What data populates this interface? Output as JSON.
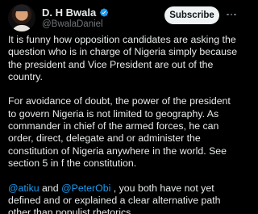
{
  "author": {
    "display_name": "D. H Bwala",
    "handle": "@BwalaDaniel",
    "verified_icon": "verified-badge-icon",
    "verified_color": "#1d9bf0"
  },
  "actions": {
    "subscribe_label": "Subscribe",
    "more_icon": "more-options-icon"
  },
  "tweet": {
    "paragraph1": "It is funny how opposition candidates are asking  the question who is in charge of Nigeria simply because the president and Vice President are out of the country.",
    "paragraph2": "For avoidance of doubt, the power of the president to govern Nigeria is not limited to geography. As commander in chief of the armed forces, he can order, direct, delegate and or administer the constitution of Nigeria anywhere in the world. See section 5 in f the constitution.",
    "mention1": "@atiku",
    "and_text": " and ",
    "mention2": "@PeterObi",
    "paragraph3_rest": " , you both have not yet defined and or explained a clear alternative path other than populist rhetorics"
  },
  "colors": {
    "background": "#000000",
    "text": "#e7e9ea",
    "secondary": "#71767b",
    "link": "#1d9bf0",
    "button_bg": "#eff3f4"
  }
}
